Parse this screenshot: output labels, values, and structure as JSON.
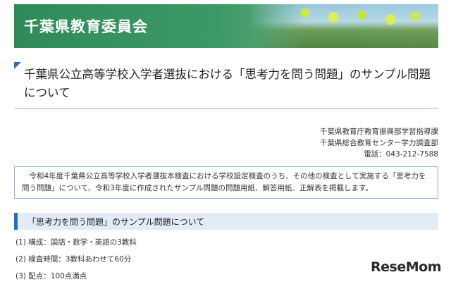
{
  "header": {
    "site_title": "千葉県教育委員会"
  },
  "page": {
    "heading": "千葉県公立高等学校入学者選抜における「思考力を問う問題」のサンプル問題について"
  },
  "contact": {
    "lines": [
      "千葉県教育庁教育振興部学習指導課",
      "千葉県総合教育センター学力調査部",
      "電話：043-212-7588"
    ]
  },
  "notice": {
    "text": "令和4年度千葉県公立高等学校入学者選抜本検査における学校設定検査のうち、その他の検査として実施する「思考力を問う問題」について、令和3年度に作成されたサンプル問題の問題用紙、解答用紙、正解表を掲載します。"
  },
  "section": {
    "title": "「思考力を問う問題」のサンプル問題について",
    "items": [
      "(1) 構成：国語・数学・英語の3教科",
      "(2) 検査時間：3教科あわせて60分",
      "(3) 配点：100点満点"
    ]
  },
  "watermark": {
    "text_main": "ReseMom",
    "text_dot": ""
  },
  "colors": {
    "banner_green": "#2f8a59",
    "accent_blue": "#2c6fb0",
    "section_bg": "#e3ecf6",
    "border_blue": "#8fc1da"
  }
}
